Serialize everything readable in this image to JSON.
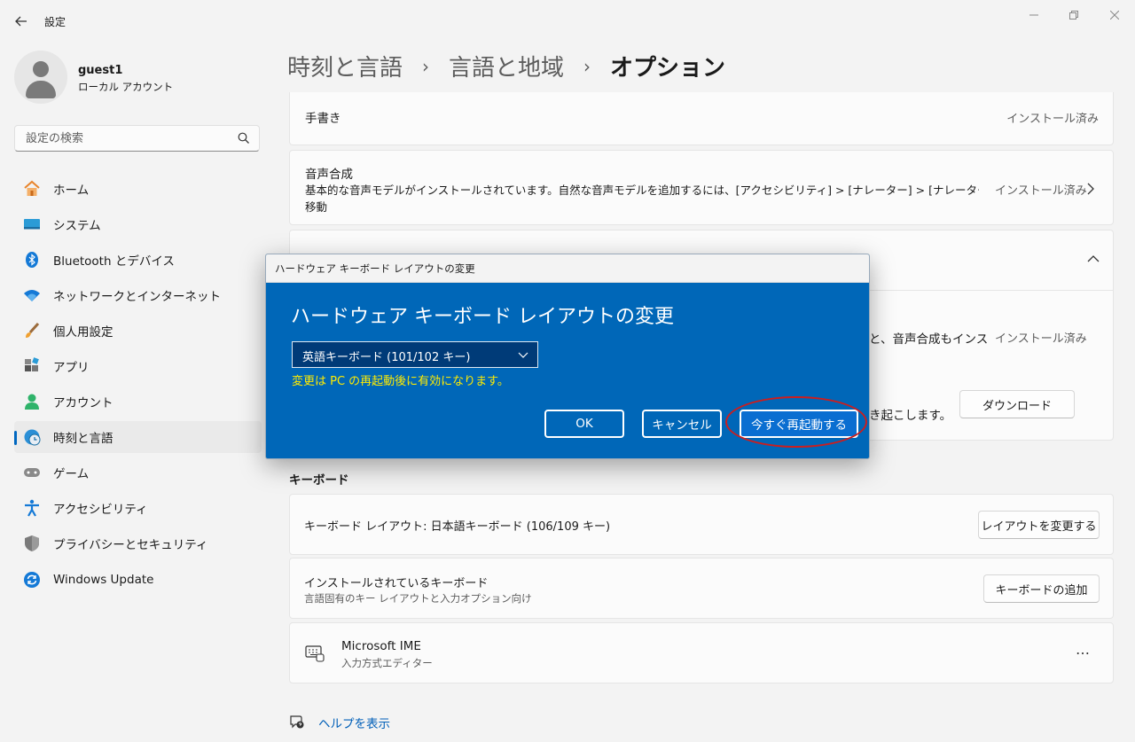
{
  "window": {
    "title": "設定",
    "back_icon": "back-arrow-icon",
    "controls": [
      "minimize",
      "restore",
      "close"
    ]
  },
  "profile": {
    "name": "guest1",
    "account_type": "ローカル アカウント"
  },
  "search": {
    "placeholder": "設定の検索"
  },
  "sidebar": {
    "items": [
      {
        "label": "ホーム",
        "icon": "home-icon"
      },
      {
        "label": "システム",
        "icon": "system-icon"
      },
      {
        "label": "Bluetooth とデバイス",
        "icon": "bluetooth-icon"
      },
      {
        "label": "ネットワークとインターネット",
        "icon": "wifi-icon"
      },
      {
        "label": "個人用設定",
        "icon": "brush-icon"
      },
      {
        "label": "アプリ",
        "icon": "apps-icon"
      },
      {
        "label": "アカウント",
        "icon": "account-icon"
      },
      {
        "label": "時刻と言語",
        "icon": "time-language-icon",
        "active": true
      },
      {
        "label": "ゲーム",
        "icon": "gamepad-icon"
      },
      {
        "label": "アクセシビリティ",
        "icon": "accessibility-icon"
      },
      {
        "label": "プライバシーとセキュリティ",
        "icon": "shield-icon"
      },
      {
        "label": "Windows Update",
        "icon": "update-icon"
      }
    ]
  },
  "breadcrumb": {
    "part1": "時刻と言語",
    "part2": "言語と地域",
    "current": "オプション",
    "separator": "›"
  },
  "features": {
    "handwriting": {
      "title": "手書き",
      "status": "インストール済み"
    },
    "speech": {
      "title": "音声合成",
      "desc_line1": "基本的な音声モデルがインストールされています。自然な音声モデルを追加するには、[アクセシビリティ] > [ナレーター] > [ナレーターの音声] に",
      "desc_line2": "移動",
      "status": "インストール済み"
    },
    "partial": {
      "text_fragment": "と、音声合成もインス",
      "status": "インストール済み",
      "desc_fragment": "き起こします。",
      "download_label": "ダウンロード"
    }
  },
  "keyboard": {
    "section_title": "キーボード",
    "layout_label": "キーボード レイアウト: 日本語キーボード (106/109 キー)",
    "change_layout_button": "レイアウトを変更する",
    "installed_title": "インストールされているキーボード",
    "installed_sub": "言語固有のキー レイアウトと入力オプション向け",
    "add_button": "キーボードの追加",
    "ime_name": "Microsoft IME",
    "ime_sub": "入力方式エディター",
    "more": "…"
  },
  "help": {
    "label": "ヘルプを表示"
  },
  "dialog": {
    "window_title": "ハードウェア キーボード レイアウトの変更",
    "heading": "ハードウェア キーボード レイアウトの変更",
    "selected_layout": "英語キーボード (101/102 キー)",
    "note": "変更は PC の再起動後に有効になります。",
    "ok_label": "OK",
    "cancel_label": "キャンセル",
    "restart_label": "今すぐ再起動する"
  },
  "colors": {
    "accent": "#0067c0",
    "dialog_bg": "#0067b8",
    "note_yellow": "#ffeb00",
    "annotation_red": "#cc1e1e"
  }
}
